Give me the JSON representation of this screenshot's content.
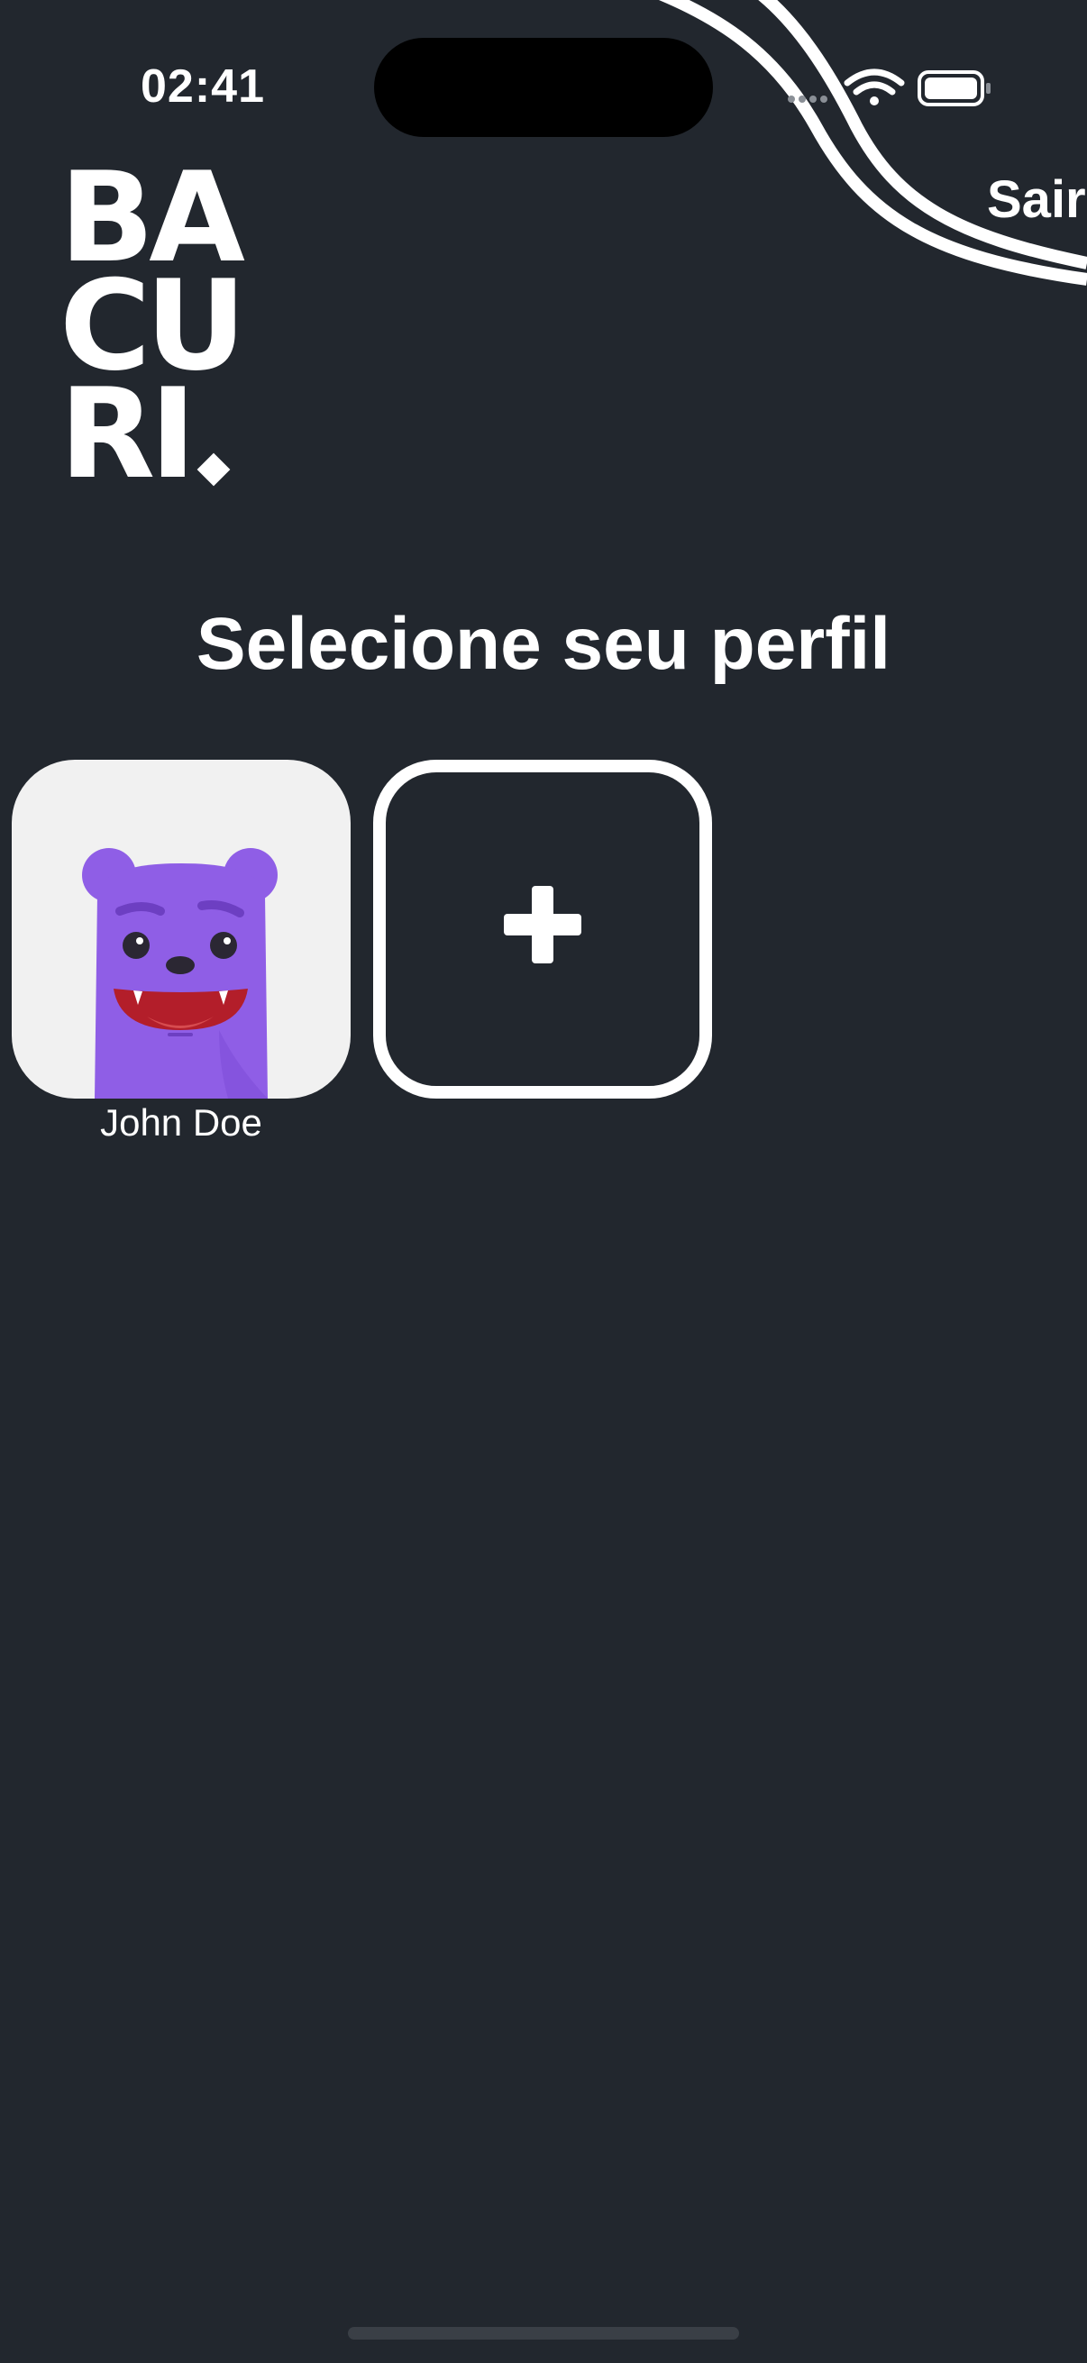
{
  "status_bar": {
    "time": "02:41",
    "icons": [
      "cellular-icon",
      "wifi-icon",
      "battery-icon"
    ]
  },
  "header": {
    "logo": {
      "line1": "BA",
      "line2": "CU",
      "line3": "RI"
    },
    "logout_label": "Sair"
  },
  "main": {
    "title": "Selecione seu perfil",
    "profiles": [
      {
        "name": "John Doe",
        "avatar": "purple-monster-avatar"
      }
    ],
    "add_profile_icon": "plus-icon"
  },
  "colors": {
    "background": "#22272e",
    "text": "#ffffff",
    "avatar_bg": "#f1f1f1",
    "avatar_monster": "#8f5ee6"
  }
}
